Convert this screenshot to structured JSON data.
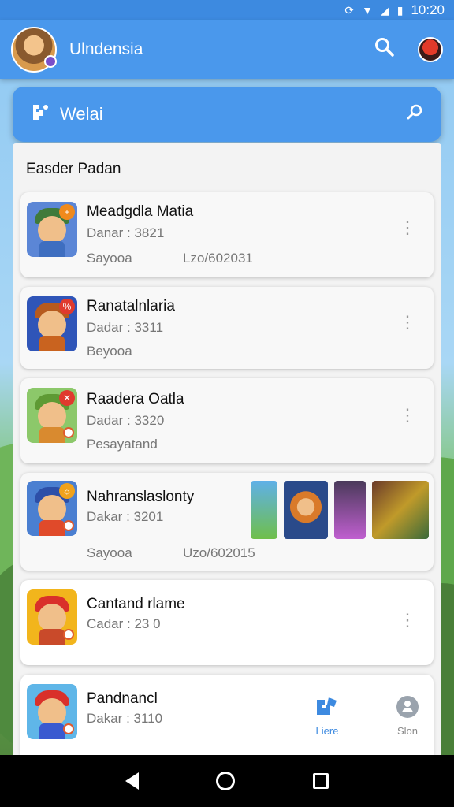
{
  "status_bar": {
    "time": "10:20",
    "icons": [
      "sync-icon",
      "wifi-icon",
      "signal-icon",
      "battery-icon"
    ]
  },
  "app_bar": {
    "title": "Ulndensia"
  },
  "search_card": {
    "label": "Welai"
  },
  "section_title": "Easder Padan",
  "games": [
    {
      "name": "Meadgdla Matia",
      "sub1": "Danar : 3821",
      "sub2": "Sayooa",
      "sub3": "Lzo/602031"
    },
    {
      "name": "Ranatalnlaria",
      "sub1": "Dadar : 3311",
      "sub2": "Beyooa"
    },
    {
      "name": "Raadera Oatla",
      "sub1": "Dadar : 3320",
      "sub2": "Pesayatand"
    },
    {
      "name": "Nahranslaslonty",
      "sub1": "Dakar : 3201",
      "sub2": "Sayooa",
      "sub3": "Uzo/602015"
    },
    {
      "name": "Cantand rlame",
      "sub1": "Cadar : 23 0"
    },
    {
      "name": "Pandnancl",
      "sub1": "Dakar : 3110"
    }
  ],
  "bottom_tabs": [
    {
      "label": "Liere"
    },
    {
      "label": "Slon"
    }
  ],
  "colors": {
    "primary": "#4a98ec",
    "status": "#3d8ae0",
    "accent_tab": "#3d8ae0"
  }
}
